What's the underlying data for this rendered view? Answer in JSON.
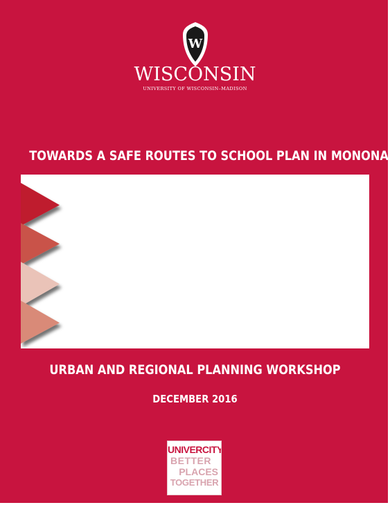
{
  "header": {
    "wordmark": "WISCONSIN",
    "subtitle": "UNIVERSITY OF WISCONSIN–MADISON",
    "crest_letter": "W"
  },
  "title": "TOWARDS A SAFE ROUTES TO SCHOOL PLAN IN MONONA",
  "workshop": "URBAN AND REGIONAL PLANNING WORKSHOP",
  "date": "DECEMBER 2016",
  "logo": {
    "line1": "UNIVERCITY",
    "line2": "BETTER",
    "line3": "PLACES",
    "line4": "TOGETHER"
  },
  "colors": {
    "background": "#c8143f",
    "arrow_1": "#bf1e2e",
    "arrow_2": "#c9524a",
    "arrow_3": "#eac3b8",
    "arrow_4": "#d98a78"
  },
  "icons": [
    "uw-crest-icon"
  ]
}
